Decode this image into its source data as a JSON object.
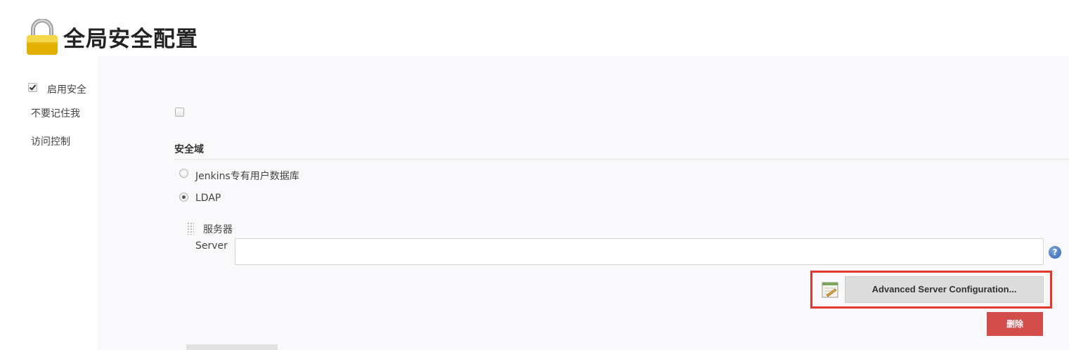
{
  "page": {
    "title": "全局安全配置"
  },
  "security": {
    "enable_security_label": "启用安全",
    "enable_security_checked": true,
    "disable_remember_me_label": "不要记住我",
    "disable_remember_me_checked": false,
    "access_control_label": "访问控制"
  },
  "realm": {
    "section_title": "安全域",
    "options": [
      {
        "label": "Jenkins专有用户数据库",
        "selected": false
      },
      {
        "label": "LDAP",
        "selected": true
      }
    ]
  },
  "ldap": {
    "server_group_label": "服务器",
    "server_label": "Server",
    "server_value": "",
    "advanced_button_label": "Advanced Server Configuration...",
    "delete_button_label": "删除"
  },
  "colors": {
    "highlight": "#e0382c",
    "delete_button": "#d24d4b",
    "help_icon": "#2d62b0"
  },
  "icons": {
    "title": "lock-icon",
    "help": "help-icon",
    "advanced": "notepad-icon",
    "drag": "grip-icon"
  }
}
